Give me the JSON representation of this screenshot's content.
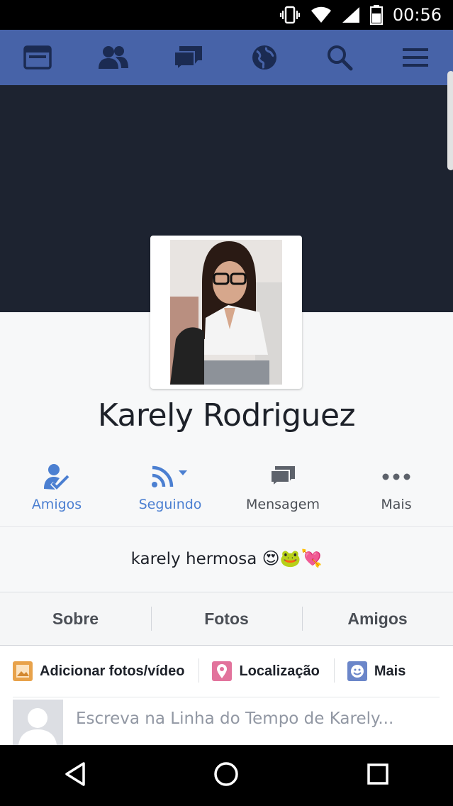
{
  "status_bar": {
    "time": "00:56",
    "icons": [
      "vibrate-icon",
      "wifi-icon",
      "signal-icon",
      "battery-icon"
    ]
  },
  "top_nav": {
    "items": [
      "news-feed-icon",
      "friend-requests-icon",
      "messages-icon",
      "notifications-globe-icon",
      "search-icon",
      "menu-icon"
    ],
    "color": "#4763a8"
  },
  "profile": {
    "name": "Karely Rodriguez",
    "bio_text": "karely hermosa",
    "bio_emoji": "😍🐸💘"
  },
  "actions": [
    {
      "label": "Amigos",
      "icon": "friends-check-icon",
      "active": true
    },
    {
      "label": "Seguindo",
      "icon": "rss-follow-icon",
      "active": true
    },
    {
      "label": "Mensagem",
      "icon": "message-icon",
      "active": false
    },
    {
      "label": "Mais",
      "icon": "more-dots-icon",
      "active": false
    }
  ],
  "tabs": [
    "Sobre",
    "Fotos",
    "Amigos"
  ],
  "composer": {
    "add_photos": "Adicionar fotos/vídeo",
    "location": "Localização",
    "more": "Mais",
    "placeholder": "Escreva na Linha do Tempo de Karely..."
  },
  "colors": {
    "active_blue": "#4b7fd1",
    "gray_text": "#4b4f56",
    "cover": "#1d2330"
  }
}
